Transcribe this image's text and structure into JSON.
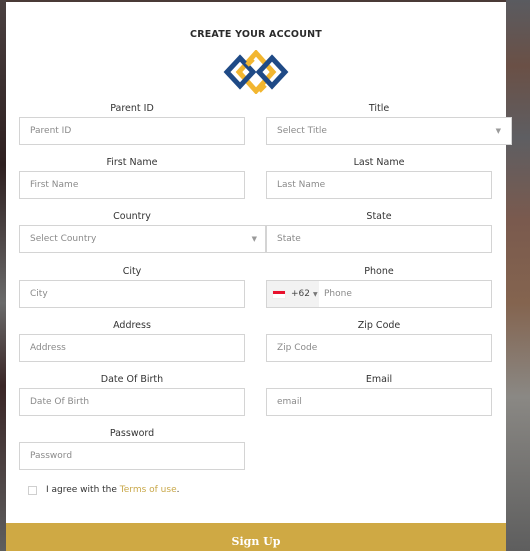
{
  "form": {
    "title": "CREATE YOUR ACCOUNT",
    "logo": "interlocked-diamonds-logo",
    "brand_colors": {
      "navy": "#1f4a86",
      "gold": "#f2b630",
      "button": "#cfa944",
      "link": "#c9a84a"
    },
    "fields": {
      "parent_id": {
        "label": "Parent ID",
        "placeholder": "Parent ID",
        "value": ""
      },
      "title": {
        "label": "Title",
        "placeholder": "Select Title",
        "selected": "Select Title"
      },
      "first_name": {
        "label": "First Name",
        "placeholder": "First Name",
        "value": ""
      },
      "last_name": {
        "label": "Last Name",
        "placeholder": "Last Name",
        "value": ""
      },
      "country": {
        "label": "Country",
        "placeholder": "Select Country",
        "selected": "Select Country"
      },
      "state": {
        "label": "State",
        "placeholder": "State",
        "value": ""
      },
      "city": {
        "label": "City",
        "placeholder": "City",
        "value": ""
      },
      "phone": {
        "label": "Phone",
        "country_code": "+62",
        "flag": "indonesia-flag",
        "placeholder": "Phone",
        "value": ""
      },
      "address": {
        "label": "Address",
        "placeholder": "Address",
        "value": ""
      },
      "zip_code": {
        "label": "Zip Code",
        "placeholder": "Zip Code",
        "value": ""
      },
      "date_of_birth": {
        "label": "Date Of Birth",
        "placeholder": "Date Of Birth",
        "value": ""
      },
      "email": {
        "label": "Email",
        "placeholder": "email",
        "value": ""
      },
      "password": {
        "label": "Password",
        "placeholder": "Password",
        "value": ""
      }
    },
    "terms": {
      "prefix": "I agree with the ",
      "link_text": "Terms of use",
      "suffix": ".",
      "checked": false
    },
    "submit_label": "Sign Up"
  }
}
